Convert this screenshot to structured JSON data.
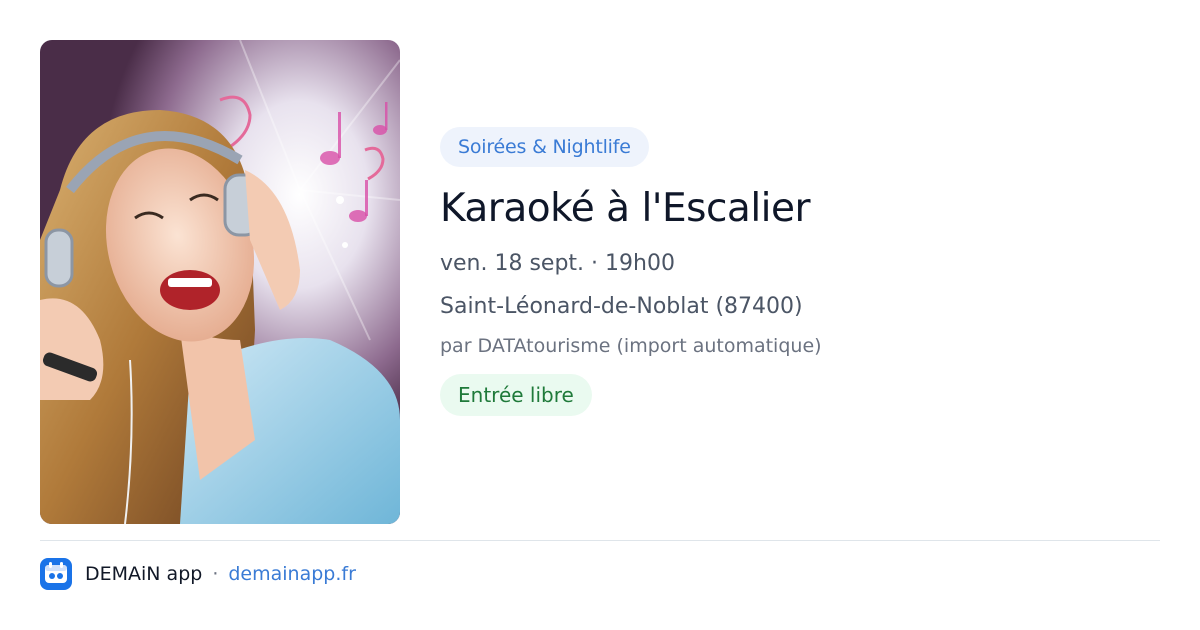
{
  "event": {
    "category": "Soirées & Nightlife",
    "title": "Karaoké à l'Escalier",
    "date_time": "ven. 18 sept. · 19h00",
    "location": "Saint-Léonard-de-Noblat (87400)",
    "organizer": "par DATAtourisme (import automatique)",
    "price": "Entrée libre",
    "image_description_icon": "singer-with-headphones-photo"
  },
  "footer": {
    "app_name": "DEMAiN app",
    "separator": "·",
    "domain": "demainapp.fr",
    "logo_icon": "demain-app-logo-icon"
  },
  "colors": {
    "category_chip_bg": "#eef3fc",
    "category_chip_text": "#3a7bd5",
    "price_chip_bg": "#eafaf0",
    "price_chip_text": "#1f7a3a",
    "title_text": "#0f1729",
    "link": "#3a7bd5",
    "logo_bg": "#1a73e8"
  }
}
